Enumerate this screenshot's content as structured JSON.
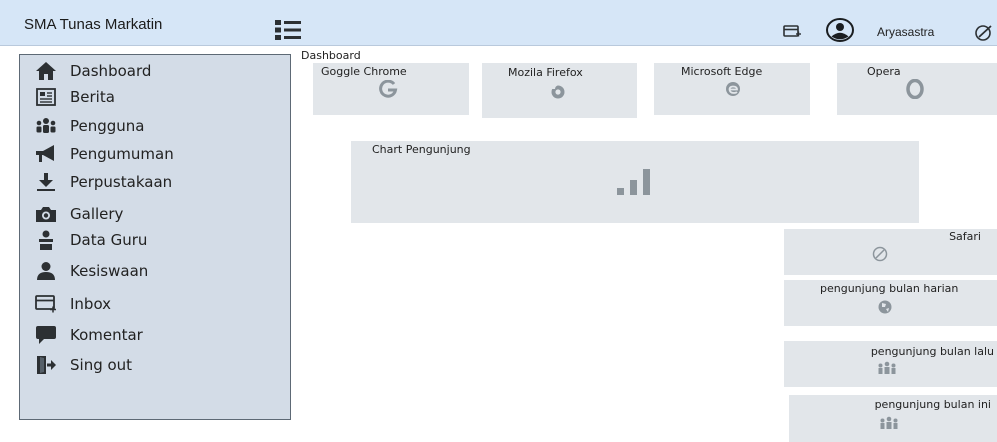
{
  "header": {
    "app_title": "SMA Tunas Markatin",
    "username": "Aryasastra",
    "icons": [
      "menu-icon",
      "inbox-icon",
      "avatar-icon",
      "edit-icon"
    ]
  },
  "sidebar": {
    "items": [
      {
        "label": "Dashboard",
        "icon": "home-icon"
      },
      {
        "label": "Berita",
        "icon": "newspaper-icon"
      },
      {
        "label": "Pengguna",
        "icon": "users-icon"
      },
      {
        "label": "Pengumuman",
        "icon": "megaphone-icon"
      },
      {
        "label": "Perpustakaan",
        "icon": "download-icon"
      },
      {
        "label": "Gallery",
        "icon": "camera-icon"
      },
      {
        "label": "Data Guru",
        "icon": "teacher-icon"
      },
      {
        "label": "Kesiswaan",
        "icon": "student-icon"
      },
      {
        "label": "Inbox",
        "icon": "inbox-icon"
      },
      {
        "label": "Komentar",
        "icon": "comment-icon"
      },
      {
        "label": "Sing out",
        "icon": "signout-icon"
      }
    ]
  },
  "main": {
    "breadcrumb": "Dashboard",
    "browser_cards": [
      {
        "title": "Goggle Chrome",
        "icon": "google-icon"
      },
      {
        "title": "Mozila  Firefox",
        "icon": "firefox-icon"
      },
      {
        "title": "Microsoft Edge",
        "icon": "edge-icon"
      },
      {
        "title": "Opera",
        "icon": "opera-icon"
      }
    ],
    "chart_card": {
      "title": "Chart Pengunjung",
      "icon": "bar-chart-icon"
    },
    "stat_cards": [
      {
        "title": "Safari",
        "icon": "compass-icon"
      },
      {
        "title": "pengunjung bulan harian",
        "icon": "globe-icon"
      },
      {
        "title": "pengunjung bulan lalu",
        "icon": "users-icon"
      },
      {
        "title": "pengunjung bulan ini",
        "icon": "users-icon"
      }
    ]
  },
  "colors": {
    "topbar": "#d6e6f7",
    "sidebar": "#d3dce7",
    "card": "#e2e6ea",
    "icon_dark": "#2c3033",
    "icon_muted": "#8c959c"
  }
}
